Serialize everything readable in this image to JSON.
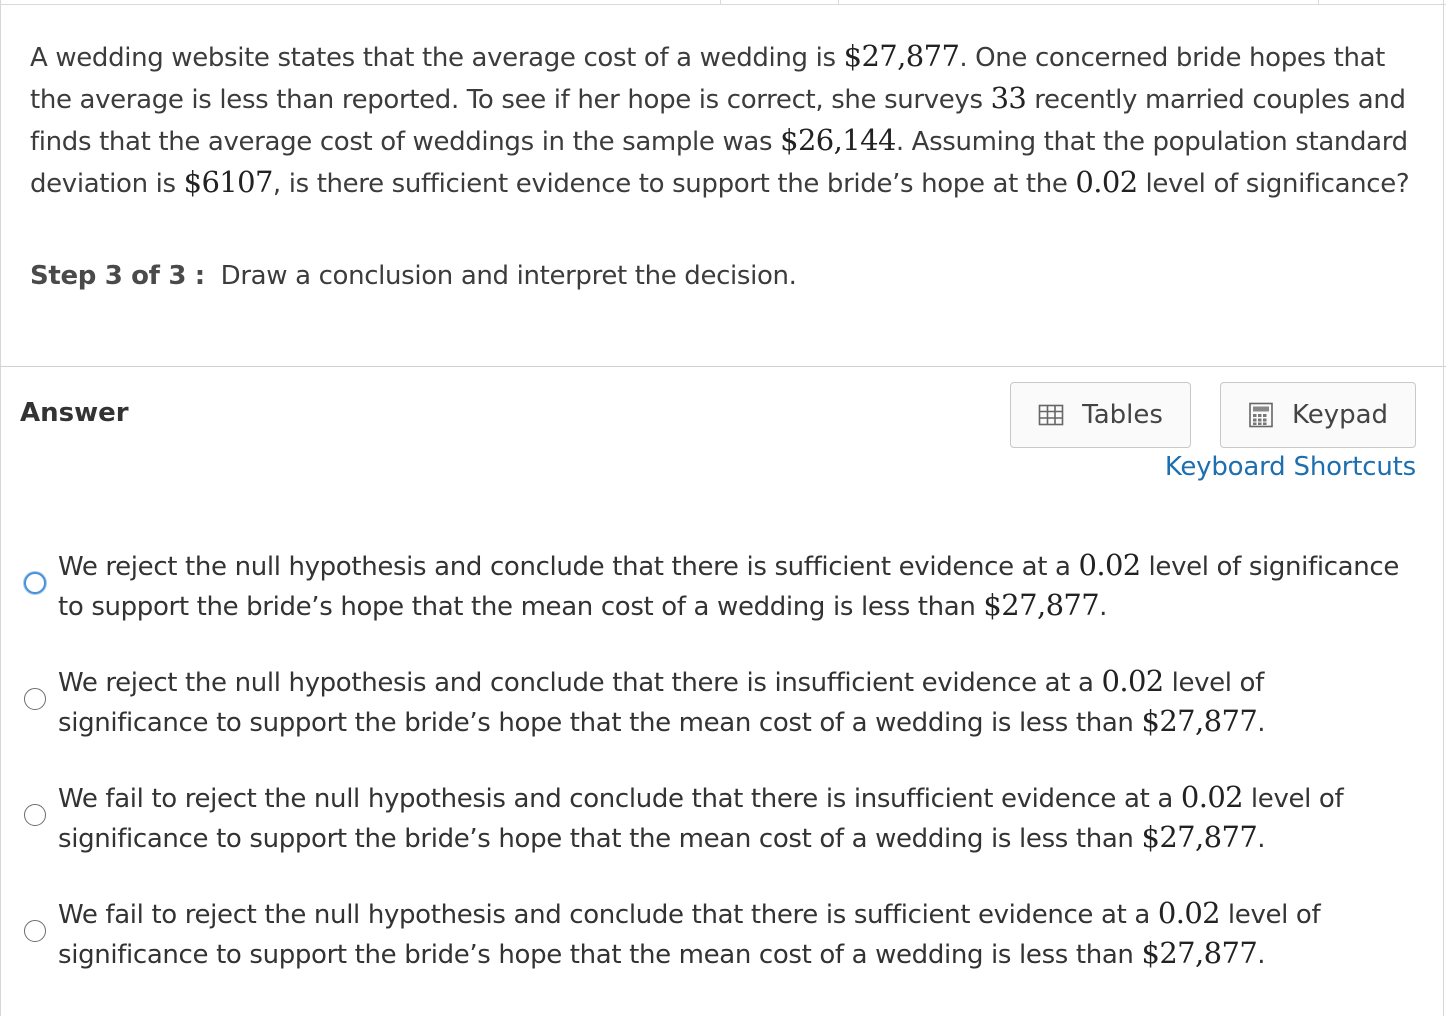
{
  "question": {
    "t1": "A wedding website states that the average cost of a wedding is ",
    "m1": "$27,877",
    "t2": ". One concerned bride hopes that the average is less than reported. To see if her hope is correct, she surveys ",
    "m2": "33",
    "t3": " recently married couples and finds that the average cost of weddings in the sample was ",
    "m3": "$26,144",
    "t4": ". Assuming that the population standard deviation is ",
    "m4": "$6107",
    "t5": ", is there sufficient evidence to support the bride’s hope at the ",
    "m5": "0.02",
    "t6": " level of significance?"
  },
  "step": {
    "label": "Step 3 of 3 :",
    "text": "Draw a conclusion and interpret the decision."
  },
  "answer": {
    "label": "Answer",
    "tables_label": "Tables",
    "keypad_label": "Keypad",
    "shortcuts_label": "Keyboard Shortcuts"
  },
  "options": [
    {
      "a": "We reject the null hypothesis and conclude that there is sufficient evidence at a ",
      "m1": "0.02",
      "b": " level of significance to support the bride’s hope that the mean cost of a wedding is less than ",
      "m2": "$27,877",
      "c": "."
    },
    {
      "a": "We reject the null hypothesis and conclude that there is insufficient evidence at a ",
      "m1": "0.02",
      "b": " level of significance to support the bride’s hope that the mean cost of a wedding is less than ",
      "m2": "$27,877",
      "c": "."
    },
    {
      "a": "We fail to reject the null hypothesis and conclude that there is insufficient evidence at a ",
      "m1": "0.02",
      "b": " level of significance to support the bride’s hope that the mean cost of a wedding is less than ",
      "m2": "$27,877",
      "c": "."
    },
    {
      "a": "We fail to reject the null hypothesis and conclude that there is sufficient evidence at a ",
      "m1": "0.02",
      "b": " level of significance to support the bride’s hope that the mean cost of a wedding is less than ",
      "m2": "$27,877",
      "c": "."
    }
  ],
  "colors": {
    "link": "#1d6fb0",
    "focus_ring": "#4a90d9",
    "text": "#333333"
  }
}
